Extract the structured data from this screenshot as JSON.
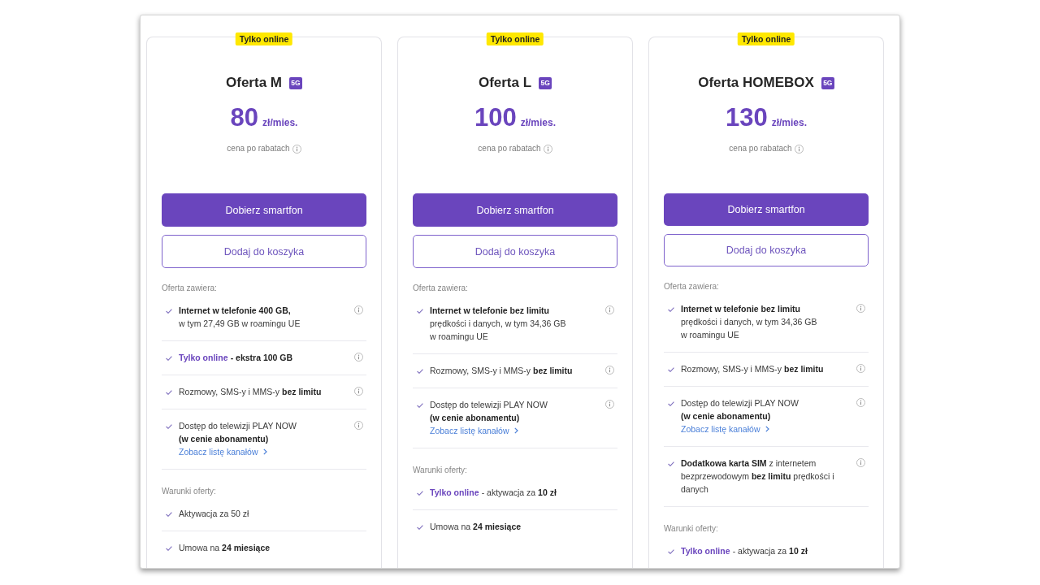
{
  "plans": [
    {
      "badge": "Tylko online",
      "title": "Oferta M",
      "network_badge": "5G",
      "price": "80",
      "price_unit": "zł/mies.",
      "price_note": "cena po rabatach",
      "primary_button": "Dobierz smartfon",
      "secondary_button": "Dodaj do koszyka",
      "includes_label": "Oferta zawiera:",
      "includes": [
        {
          "text": "**Internet w telefonie 400 GB,**\nw tym 27,49 GB w roamingu UE",
          "info": true
        },
        {
          "highlight": "Tylko online",
          "text": "**- ekstra 100 GB**",
          "info": true
        },
        {
          "text": "Rozmowy, SMS-y i MMS-y **bez limitu**",
          "info": true
        },
        {
          "text": "Dostęp do telewizji PLAY NOW\n**(w cenie abonamentu)**",
          "link": "Zobacz listę kanałów",
          "info": true
        }
      ],
      "conditions_label": "Warunki oferty:",
      "conditions": [
        {
          "text": "Aktywacja za 50 zł"
        },
        {
          "text": "Umowa na **24 miesiące**"
        }
      ]
    },
    {
      "badge": "Tylko online",
      "title": "Oferta L",
      "network_badge": "5G",
      "price": "100",
      "price_unit": "zł/mies.",
      "price_note": "cena po rabatach",
      "primary_button": "Dobierz smartfon",
      "secondary_button": "Dodaj do koszyka",
      "includes_label": "Oferta zawiera:",
      "includes": [
        {
          "text": "**Internet w telefonie bez limitu**\nprędkości i danych, w tym 34,36 GB\nw roamingu UE",
          "info": true
        },
        {
          "text": "Rozmowy, SMS-y i MMS-y **bez limitu**",
          "info": true
        },
        {
          "text": "Dostęp do telewizji PLAY NOW\n**(w cenie abonamentu)**",
          "link": "Zobacz listę kanałów",
          "info": true
        }
      ],
      "conditions_label": "Warunki oferty:",
      "conditions": [
        {
          "highlight": "Tylko online",
          "text": "- aktywacja za **10 zł**"
        },
        {
          "text": "Umowa na **24 miesiące**"
        }
      ]
    },
    {
      "badge": "Tylko online",
      "title": "Oferta HOMEBOX",
      "network_badge": "5G",
      "price": "130",
      "price_unit": "zł/mies.",
      "price_note": "cena po rabatach",
      "primary_button": "Dobierz smartfon",
      "secondary_button": "Dodaj do koszyka",
      "includes_label": "Oferta zawiera:",
      "includes": [
        {
          "text": "**Internet w telefonie bez limitu**\nprędkości i danych, w tym 34,36 GB\nw roamingu UE",
          "info": true
        },
        {
          "text": "Rozmowy, SMS-y i MMS-y **bez limitu**",
          "info": true
        },
        {
          "text": "Dostęp do telewizji PLAY NOW\n**(w cenie abonamentu)**",
          "link": "Zobacz listę kanałów",
          "info": true
        },
        {
          "text": "**Dodatkowa karta SIM** z internetem\nbezprzewodowym **bez limitu** prędkości i\ndanych",
          "info": true
        }
      ],
      "conditions_label": "Warunki oferty:",
      "conditions": [
        {
          "highlight": "Tylko online",
          "text": "- aktywacja za **10 zł**"
        }
      ]
    }
  ]
}
